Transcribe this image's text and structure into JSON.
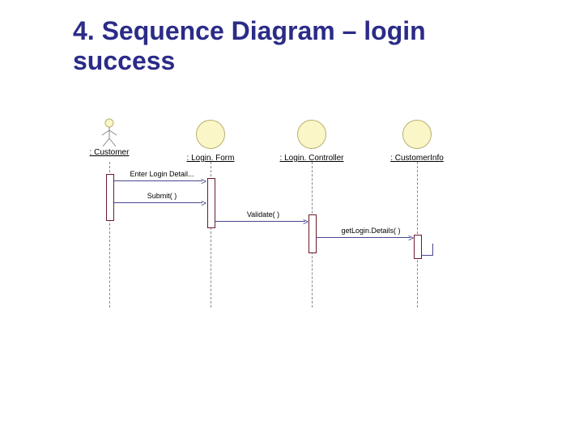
{
  "title": "4. Sequence Diagram – login success",
  "participants": {
    "customer": {
      "label": ": Customer"
    },
    "loginForm": {
      "label": ": Login. Form"
    },
    "loginController": {
      "label": ": Login. Controller"
    },
    "customerInfo": {
      "label": ": CustomerInfo"
    }
  },
  "messages": {
    "m1": {
      "label": "Enter Login Detail...",
      "from": "customer",
      "to": "loginForm"
    },
    "m2": {
      "label": "Submit( )",
      "from": "customer",
      "to": "loginForm"
    },
    "m3": {
      "label": "Validate( )",
      "from": "loginForm",
      "to": "loginController"
    },
    "m4": {
      "label": "getLogin.Details( )",
      "from": "loginController",
      "to": "customerInfo"
    }
  },
  "colors": {
    "heading": "#2b2b88",
    "objectFill": "#fbf6c7",
    "activationBorder": "#6a1a2a"
  }
}
